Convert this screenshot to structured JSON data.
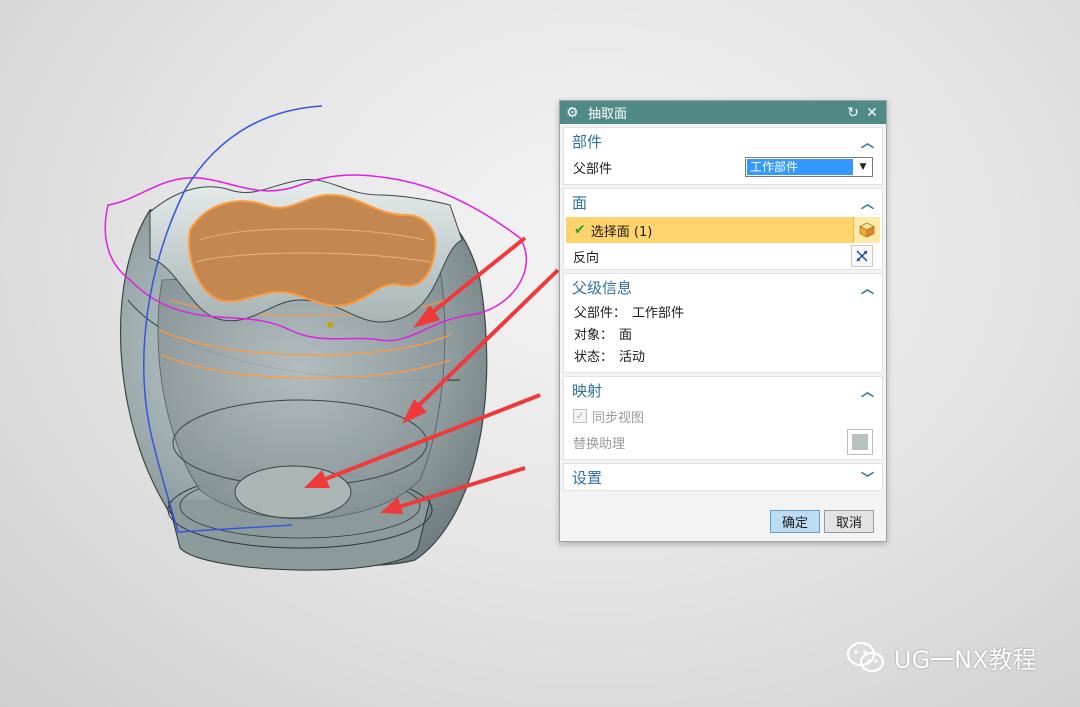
{
  "dialog": {
    "title": "抽取面",
    "part_group": {
      "title": "部件",
      "parent_part_label": "父部件",
      "parent_part_value": "工作部件"
    },
    "face_group": {
      "title": "面",
      "select_face_label": "选择面 (1)",
      "reverse_label": "反向"
    },
    "parent_info_group": {
      "title": "父级信息",
      "parent_part_key": "父部件：",
      "parent_part_val": "工作部件",
      "object_key": "对象：",
      "object_val": "面",
      "status_key": "状态：",
      "status_val": "活动"
    },
    "mapping_group": {
      "title": "映射",
      "sync_view_label": "同步视图",
      "replace_assist_label": "替换助理"
    },
    "settings_group": {
      "title": "设置"
    },
    "ok_label": "确定",
    "cancel_label": "取消"
  },
  "watermark": {
    "text": "UG一NX教程"
  },
  "icons": {
    "title": "gear-icon",
    "reset": "reset-icon",
    "close": "close-icon",
    "collapse": "chevron-up-icon",
    "expand": "chevron-down-icon",
    "select": "cube-select-icon",
    "reverse": "reverse-direction-icon",
    "check": "check-icon",
    "watermark": "wechat-icon"
  },
  "colors": {
    "titlebar": "#4f8a86",
    "group_title": "#2f6f9c",
    "selection_highlight": "#ffd46e",
    "dropdown_selected": "#3399ff",
    "model_body": "#9aa8ab",
    "guide_curve_magenta": "#e020e0",
    "guide_curve_blue": "#3355dd",
    "selected_face_edge": "#ff9a3c",
    "arrows": "#ee3a3a"
  }
}
